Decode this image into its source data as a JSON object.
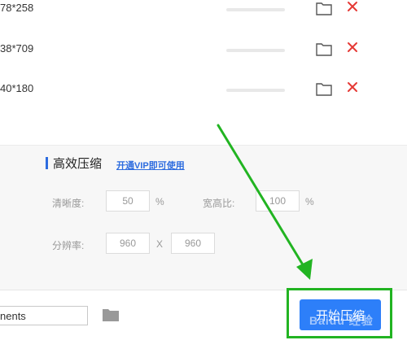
{
  "files": [
    {
      "dims": "78*258",
      "progress": 0
    },
    {
      "dims": "38*709",
      "progress": 0
    },
    {
      "dims": "40*180",
      "progress": 0
    }
  ],
  "settings": {
    "title": "高效压缩",
    "vip_link": "开通VIP即可使用",
    "clarity": {
      "label": "清晰度:",
      "value": "50",
      "unit": "%"
    },
    "aspect": {
      "label": "宽高比:",
      "value": "100",
      "unit": "%"
    },
    "resolution": {
      "label": "分辨率:",
      "width": "960",
      "separator": "X",
      "height": "960"
    }
  },
  "output": {
    "path": "nents"
  },
  "start_button": {
    "label": "开始压缩"
  },
  "watermark": "Baidu 经验",
  "colors": {
    "accent": "#2d7ff9",
    "delete": "#e53935",
    "annotation": "#22b422"
  }
}
